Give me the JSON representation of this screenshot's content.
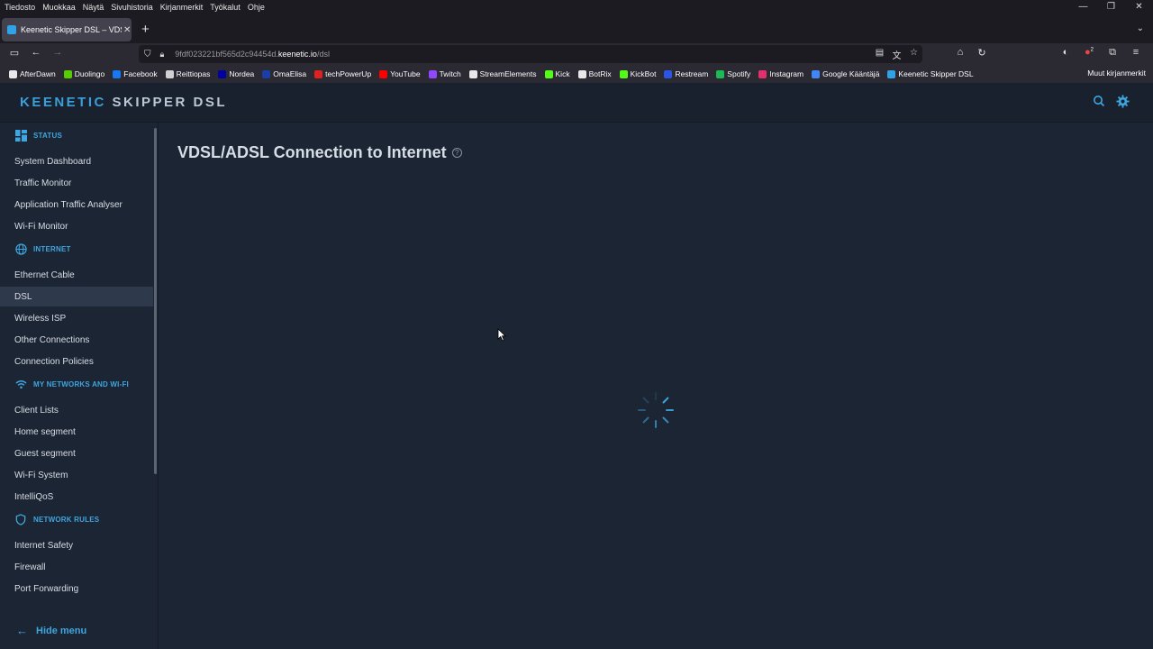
{
  "browser": {
    "menu": [
      "Tiedosto",
      "Muokkaa",
      "Näytä",
      "Sivuhistoria",
      "Kirjanmerkit",
      "Työkalut",
      "Ohje"
    ],
    "tab_title": "Keenetic Skipper DSL – VDSL/A",
    "url_prefix": "9fdf023221bf565d2c94454d.",
    "url_domain": "keenetic.io",
    "url_path": "/dsl",
    "notification_badge": "2",
    "bookmarks": [
      {
        "label": "AfterDawn",
        "color": "#e8e8e8"
      },
      {
        "label": "Duolingo",
        "color": "#58cc02"
      },
      {
        "label": "Facebook",
        "color": "#1877f2"
      },
      {
        "label": "Reittiopas",
        "color": "#d0d0d0"
      },
      {
        "label": "Nordea",
        "color": "#0000a0"
      },
      {
        "label": "OmaElisa",
        "color": "#1a3ea8"
      },
      {
        "label": "techPowerUp",
        "color": "#d22"
      },
      {
        "label": "YouTube",
        "color": "#ff0000"
      },
      {
        "label": "Twitch",
        "color": "#9146ff"
      },
      {
        "label": "StreamElements",
        "color": "#e8e8e8"
      },
      {
        "label": "Kick",
        "color": "#53fc18"
      },
      {
        "label": "BotRix",
        "color": "#e8e8e8"
      },
      {
        "label": "KickBot",
        "color": "#53fc18"
      },
      {
        "label": "Restream",
        "color": "#2a55e5"
      },
      {
        "label": "Spotify",
        "color": "#1db954"
      },
      {
        "label": "Instagram",
        "color": "#e1306c"
      },
      {
        "label": "Google Kääntäjä",
        "color": "#4285f4"
      },
      {
        "label": "Keenetic Skipper DSL",
        "color": "#2fa3e6"
      }
    ],
    "other_bookmarks": "Muut kirjanmerkit"
  },
  "header": {
    "logo_brand": "KEENETIC",
    "logo_model": "SKIPPER DSL",
    "accent": "#3ea6e0"
  },
  "sidebar": {
    "groups": [
      {
        "label": "STATUS",
        "icon": "dashboard-icon",
        "items": [
          "System Dashboard",
          "Traffic Monitor",
          "Application Traffic Analyser",
          "Wi-Fi Monitor"
        ]
      },
      {
        "label": "INTERNET",
        "icon": "globe-icon",
        "items": [
          "Ethernet Cable",
          "DSL",
          "Wireless ISP",
          "Other Connections",
          "Connection Policies"
        ]
      },
      {
        "label": "MY NETWORKS AND WI-FI",
        "icon": "wifi-icon",
        "items": [
          "Client Lists",
          "Home segment",
          "Guest segment",
          "Wi-Fi System",
          "IntelliQoS"
        ]
      },
      {
        "label": "NETWORK RULES",
        "icon": "shield-icon",
        "items": [
          "Internet Safety",
          "Firewall",
          "Port Forwarding"
        ]
      }
    ],
    "active_item": "DSL",
    "hide_menu": "Hide menu"
  },
  "main": {
    "title": "VDSL/ADSL Connection to Internet",
    "help": "?"
  }
}
